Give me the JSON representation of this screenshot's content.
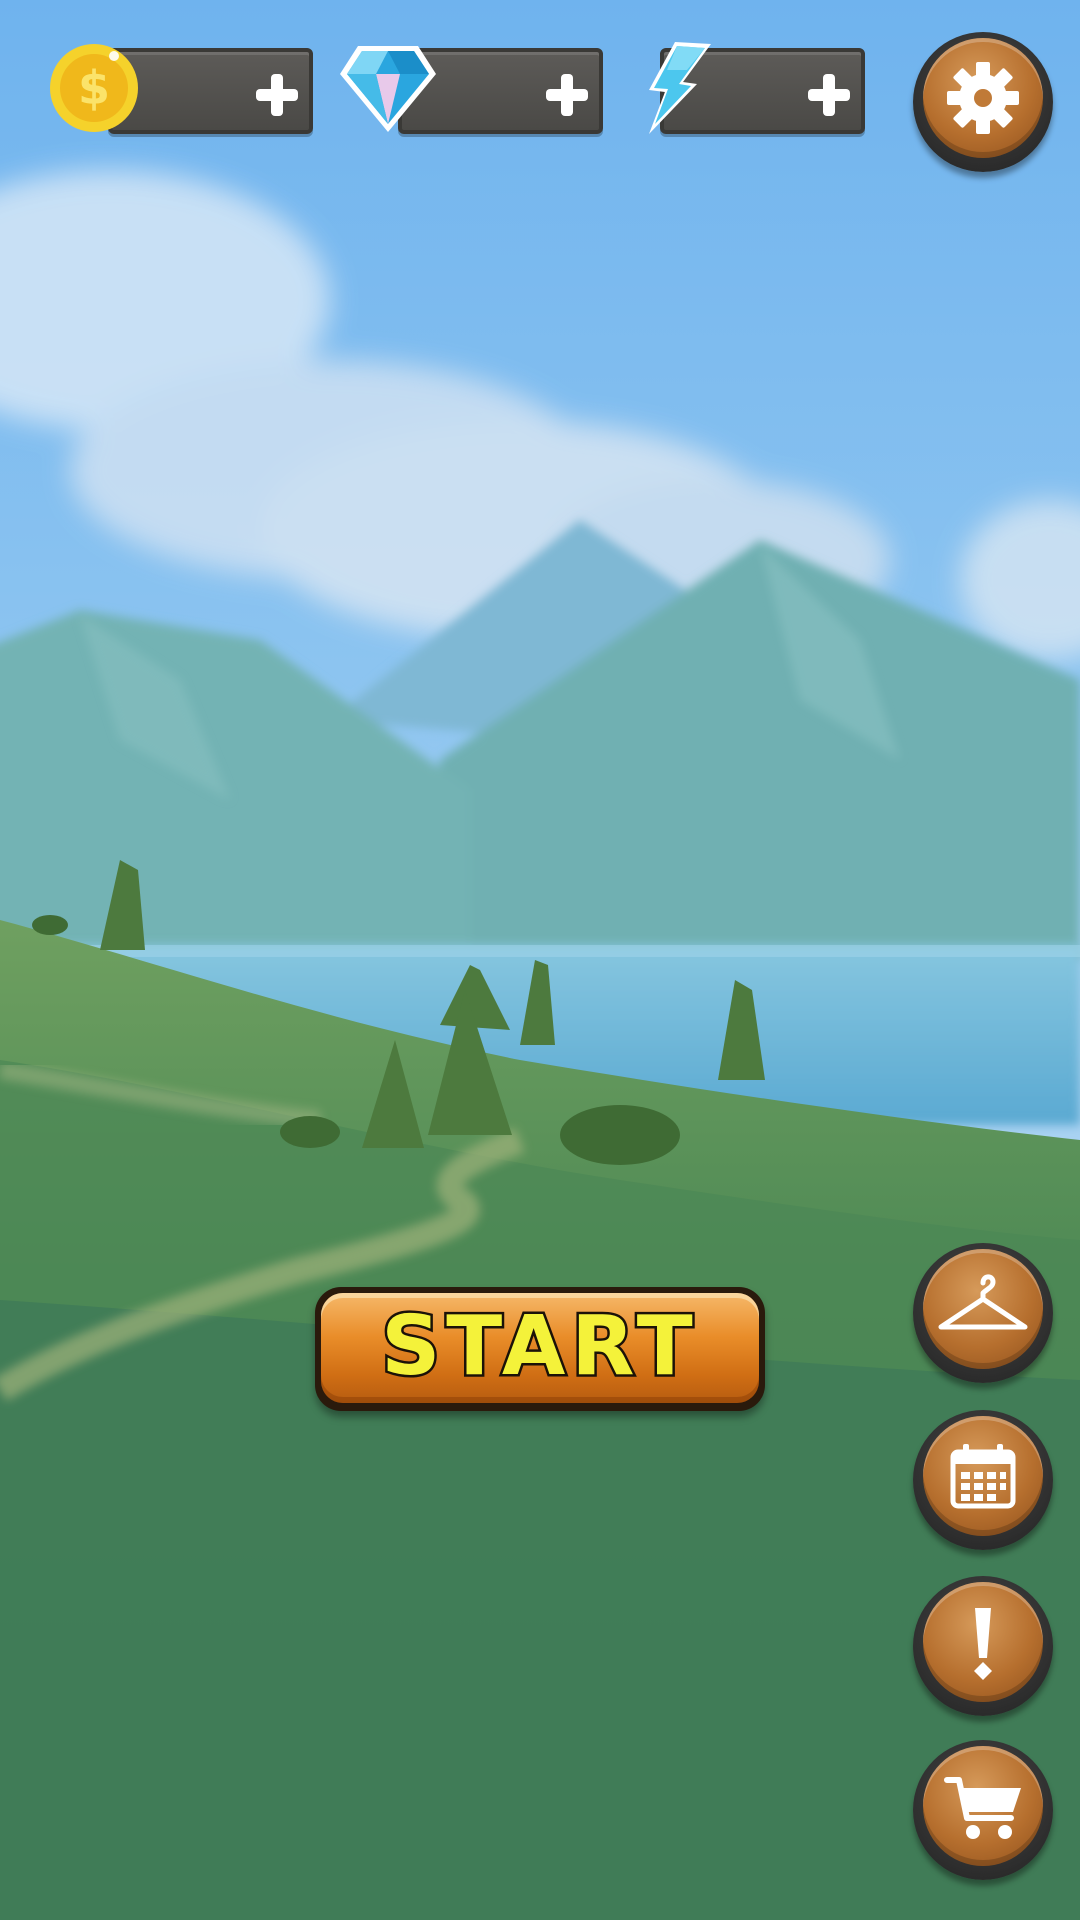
{
  "screen": "main-menu",
  "currencies": [
    {
      "id": "coins",
      "icon": "gold-coin-icon",
      "value": "",
      "add_icon": "plus-icon"
    },
    {
      "id": "gems",
      "icon": "blue-diamond-icon",
      "value": "",
      "add_icon": "plus-icon"
    },
    {
      "id": "energy",
      "icon": "lightning-bolt-icon",
      "value": "",
      "add_icon": "plus-icon"
    }
  ],
  "settings_button": {
    "icon": "gear-icon"
  },
  "start_button": {
    "label": "START"
  },
  "side_menu": [
    {
      "id": "wardrobe",
      "icon": "hanger-icon"
    },
    {
      "id": "calendar",
      "icon": "calendar-icon"
    },
    {
      "id": "notices",
      "icon": "exclamation-icon"
    },
    {
      "id": "shop",
      "icon": "shopping-cart-icon"
    }
  ],
  "colors": {
    "button_orange": "#c37a36",
    "start_text": "#f4f23a",
    "slot_gray": "#555350",
    "sky": "#79b9ee",
    "grass": "#3f7b57"
  }
}
